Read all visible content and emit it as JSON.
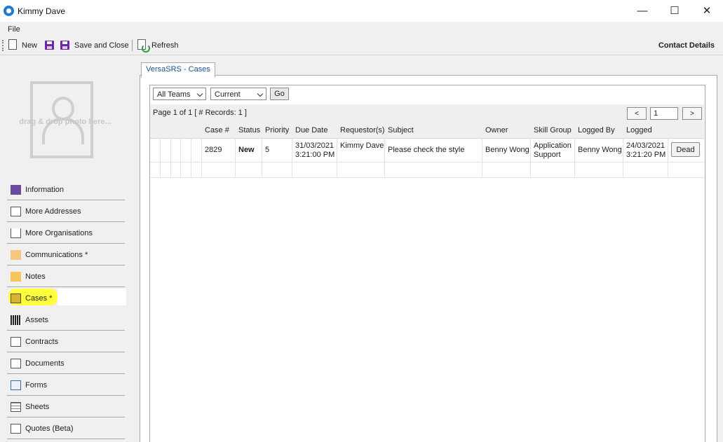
{
  "window": {
    "title": "Kimmy Dave",
    "minimize": "—",
    "maximize": "☐",
    "close": "✕"
  },
  "menu": {
    "file": "File"
  },
  "toolbar": {
    "new_label": "New",
    "save_close_label": "Save and Close",
    "refresh_label": "Refresh",
    "contact_details": "Contact Details"
  },
  "photo": {
    "placeholder": "drag & drop photo here..."
  },
  "sidebar": {
    "items": [
      {
        "label": "Information",
        "icon": "info-icon"
      },
      {
        "label": "More Addresses",
        "icon": "address-book-icon"
      },
      {
        "label": "More Organisations",
        "icon": "house-icon"
      },
      {
        "label": "Communications  *",
        "icon": "envelope-icon"
      },
      {
        "label": "Notes",
        "icon": "note-icon"
      },
      {
        "label": "Cases  *",
        "icon": "folder-icon",
        "active": true
      },
      {
        "label": "Assets",
        "icon": "barcode-icon"
      },
      {
        "label": "Contracts",
        "icon": "contract-icon"
      },
      {
        "label": "Documents",
        "icon": "documents-icon"
      },
      {
        "label": "Forms",
        "icon": "form-icon"
      },
      {
        "label": "Sheets",
        "icon": "sheet-icon"
      },
      {
        "label": "Quotes (Beta)",
        "icon": "quote-icon"
      }
    ]
  },
  "tab": {
    "label": "VersaSRS - Cases"
  },
  "filters": {
    "team": "All Teams",
    "status": "Current",
    "go": "Go"
  },
  "pager": {
    "info": "Page 1 of 1 [ # Records: 1 ]",
    "prev": "<",
    "page": "1",
    "next": ">"
  },
  "table": {
    "headers": [
      "Case #",
      "Status",
      "Priority",
      "Due Date",
      "Requestor(s)",
      "Subject",
      "Owner",
      "Skill Group",
      "Logged By",
      "Logged"
    ],
    "row": {
      "case": "2829",
      "status": "New",
      "priority": "5",
      "due_date_1": "31/03/2021",
      "due_date_2": "3:21:00 PM",
      "requestor": "Kimmy Dave",
      "subject": "Please check the style",
      "owner": "Benny Wong",
      "skill_group_1": "Application",
      "skill_group_2": "Support",
      "logged_by": "Benny Wong",
      "logged_1": "24/03/2021",
      "logged_2": "3:21:20 PM",
      "action": "Dead"
    }
  },
  "colors": {
    "highlight": "#ffff33",
    "tab_text": "#1a4f8c",
    "save_icon": "#6a2aa8"
  }
}
